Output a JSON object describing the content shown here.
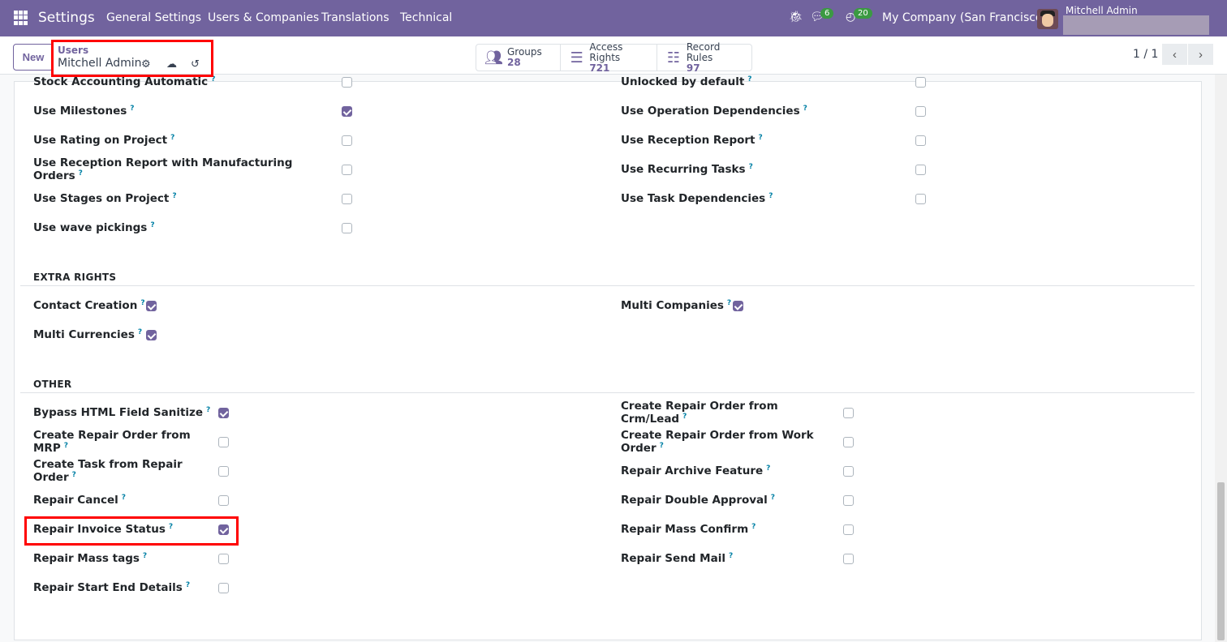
{
  "navbar": {
    "brand": "Settings",
    "menus": [
      "General Settings",
      "Users & Companies",
      "Translations",
      "Technical"
    ],
    "messages_count": "6",
    "activities_count": "20",
    "company": "My Company (San Francisco)",
    "user": "Mitchell Admin"
  },
  "control_panel": {
    "new_label": "New",
    "breadcrumb_parent": "Users",
    "breadcrumb_current": "Mitchell Admin",
    "stats": [
      {
        "label": "Groups",
        "value": "28",
        "icon": "users-icon"
      },
      {
        "label": "Access Rights",
        "value": "721",
        "icon": "list-icon"
      },
      {
        "label": "Record Rules",
        "value": "97",
        "icon": "list-ul-icon"
      }
    ],
    "pager": "1 / 1"
  },
  "colors": {
    "primary": "#71639e",
    "highlight": "#ff0000"
  },
  "sections": [
    {
      "id": "s1",
      "title": "",
      "left": [
        {
          "label": "Stock Accounting Automatic",
          "checked": false
        },
        {
          "label": "Use Milestones",
          "checked": true
        },
        {
          "label": "Use Rating on Project",
          "checked": false
        },
        {
          "label": "Use Reception Report with Manufacturing Orders",
          "checked": false
        },
        {
          "label": "Use Stages on Project",
          "checked": false
        },
        {
          "label": "Use wave pickings",
          "checked": false
        }
      ],
      "right": [
        {
          "label": "Unlocked by default",
          "checked": false
        },
        {
          "label": "Use Operation Dependencies",
          "checked": false
        },
        {
          "label": "Use Reception Report",
          "checked": false
        },
        {
          "label": "Use Recurring Tasks",
          "checked": false
        },
        {
          "label": "Use Task Dependencies",
          "checked": false
        }
      ]
    },
    {
      "id": "s2",
      "title": "EXTRA RIGHTS",
      "left": [
        {
          "label": "Contact Creation",
          "checked": true
        },
        {
          "label": "Multi Currencies",
          "checked": true
        }
      ],
      "right": [
        {
          "label": "Multi Companies",
          "checked": true
        }
      ]
    },
    {
      "id": "s3",
      "title": "OTHER",
      "left": [
        {
          "label": "Bypass HTML Field Sanitize",
          "checked": true
        },
        {
          "label": "Create Repair Order from MRP",
          "checked": false
        },
        {
          "label": "Create Task from Repair Order",
          "checked": false
        },
        {
          "label": "Repair Cancel",
          "checked": false
        },
        {
          "label": "Repair Invoice Status",
          "checked": true
        },
        {
          "label": "Repair Mass tags",
          "checked": false
        },
        {
          "label": "Repair Start End Details",
          "checked": false
        }
      ],
      "right": [
        {
          "label": "Create Repair Order from Crm/Lead",
          "checked": false
        },
        {
          "label": "Create Repair Order from Work Order",
          "checked": false
        },
        {
          "label": "Repair Archive Feature",
          "checked": false
        },
        {
          "label": "Repair Double Approval",
          "checked": false
        },
        {
          "label": "Repair Mass Confirm",
          "checked": false
        },
        {
          "label": "Repair Send Mail",
          "checked": false
        }
      ]
    }
  ],
  "help_mark": "?"
}
